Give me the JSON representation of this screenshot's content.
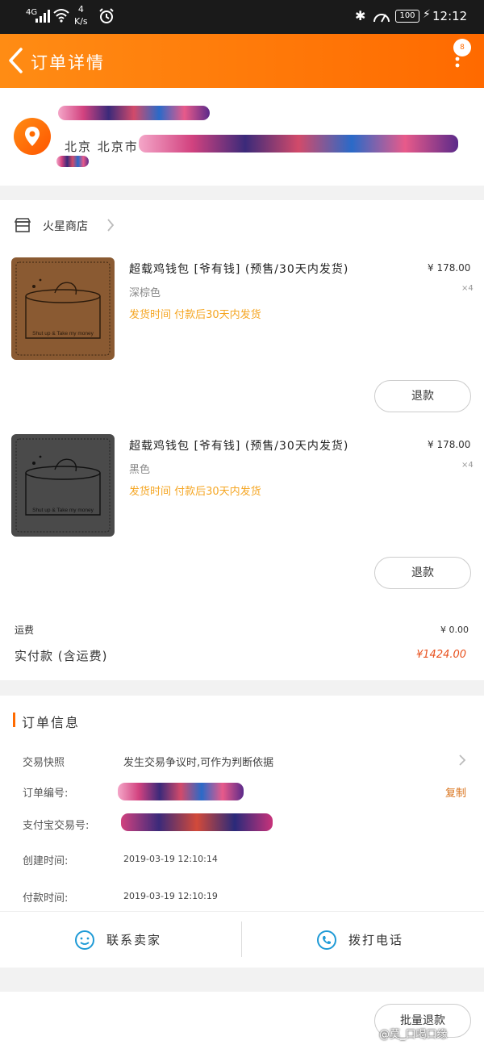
{
  "statusbar": {
    "network": "4G",
    "speed_num": "4",
    "speed_unit": "K/s",
    "battery": "100",
    "time": "12:12"
  },
  "header": {
    "title": "订单详情",
    "badge": "8"
  },
  "address": {
    "city": "北京 北京市"
  },
  "shop": {
    "name": "火星商店"
  },
  "items": [
    {
      "name": "超载鸡钱包 [爷有钱] (预售/30天内发货)",
      "price": "¥ 178.00",
      "spec": "深棕色",
      "qty": "×4",
      "ship": "发货时间 付款后30天内发货",
      "refund": "退款",
      "thumb_text": "Shut up & Take my money",
      "thumb_color": "#8a5a32"
    },
    {
      "name": "超载鸡钱包 [爷有钱] (预售/30天内发货)",
      "price": "¥ 178.00",
      "spec": "黑色",
      "qty": "×4",
      "ship": "发货时间 付款后30天内发货",
      "refund": "退款",
      "thumb_text": "Shut up & Take my money",
      "thumb_color": "#4a4a4a"
    }
  ],
  "totals": {
    "fee_label": "运费",
    "fee_value": "¥ 0.00",
    "paid_label": "实付款 (含运费)",
    "paid_value": "¥1424.00"
  },
  "info": {
    "heading": "订单信息",
    "snapshot_label": "交易快照",
    "snapshot_value": "发生交易争议时,可作为判断依据",
    "order_no_label": "订单编号:",
    "copy_label": "复制",
    "alipay_label": "支付宝交易号:",
    "created_label": "创建时间:",
    "created_value": "2019-03-19 12:10:14",
    "paid_time_label": "付款时间:",
    "paid_time_value": "2019-03-19 12:10:19"
  },
  "actions": {
    "contact": "联系卖家",
    "call": "拨打电话"
  },
  "bottom": {
    "batch_refund": "批量退款",
    "watermark": "@莫_口喝口缘"
  },
  "colors": {
    "accent": "#ff6a00",
    "price": "#e8521f",
    "ship": "#f5a623"
  }
}
